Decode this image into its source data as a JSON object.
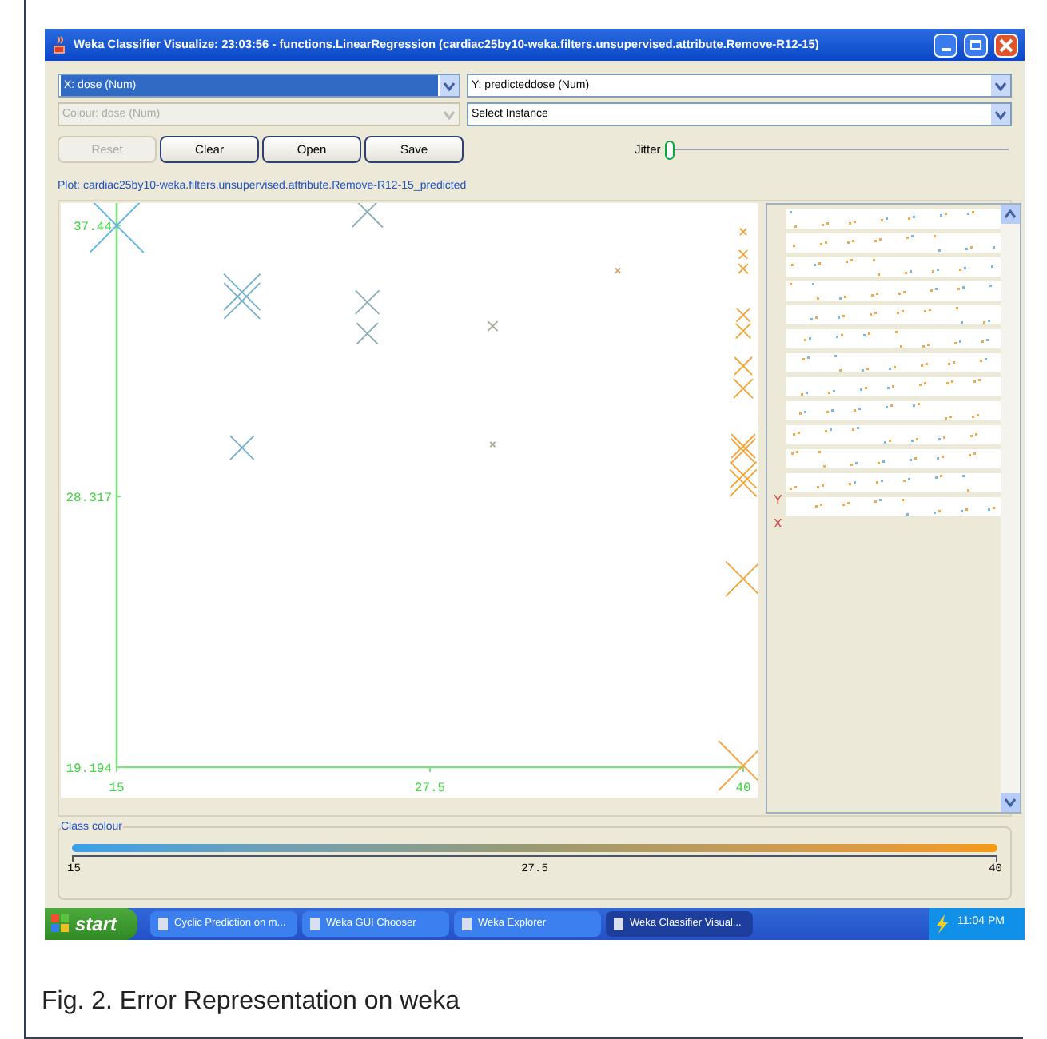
{
  "window": {
    "title": "Weka Classifier Visualize: 23:03:56 - functions.LinearRegression (cardiac25by10-weka.filters.unsupervised.attribute.Remove-R12-15)"
  },
  "selectors": [
    {
      "value": "X: dose (Num)",
      "selected": true,
      "disabled": false
    },
    {
      "value": "Y: predicteddose (Num)",
      "selected": false,
      "disabled": false
    },
    {
      "value": "Colour: dose (Num)",
      "selected": false,
      "disabled": true
    },
    {
      "value": "Select Instance",
      "selected": false,
      "disabled": false
    }
  ],
  "buttons": [
    {
      "label": "Reset",
      "disabled": true
    },
    {
      "label": "Clear",
      "disabled": false
    },
    {
      "label": "Open",
      "disabled": false
    },
    {
      "label": "Save",
      "disabled": false
    }
  ],
  "jitter": {
    "label": "Jitter",
    "level": 0
  },
  "plot": {
    "title": "Plot: cardiac25by10-weka.filters.unsupervised.attribute.Remove-R12-15_predicted",
    "chart_data": {
      "type": "scatter",
      "xlim": [
        15,
        40
      ],
      "ylim": [
        19.194,
        38.2
      ],
      "xticks": [
        15,
        27.5,
        40
      ],
      "yticks": [
        19.194,
        28.317,
        37.44
      ],
      "x": [
        15,
        20,
        20,
        25,
        25,
        25,
        20,
        30,
        30,
        35,
        40,
        40,
        40,
        40,
        40,
        40,
        40,
        40,
        40,
        40,
        40,
        40,
        40
      ],
      "series": [
        {
          "values": [
            37.44,
            35.2,
            34.9,
            37.9,
            34.86,
            33.8,
            29.96,
            34.05,
            30.07,
            35.93,
            37.23,
            36.47,
            35.99,
            34.43,
            33.89,
            32.71,
            31.95,
            30.01,
            29.85,
            29.04,
            28.77,
            25.54,
            19.25
          ]
        }
      ]
    }
  },
  "matrix": {
    "y_label": "Y",
    "x_label": "X"
  },
  "class_colour": {
    "title": "Class colour",
    "ticks": [
      "15",
      "27.5",
      "40"
    ]
  },
  "taskbar": {
    "start": "start",
    "tasks": [
      {
        "label": "Cyclic Prediction on m...",
        "selected": false
      },
      {
        "label": "Weka GUI Chooser",
        "selected": false
      },
      {
        "label": "Weka Explorer",
        "selected": false
      },
      {
        "label": "Weka Classifier Visual...",
        "selected": true
      }
    ],
    "clock": "11:04 PM"
  },
  "caption": "Fig. 2. Error Representation on weka"
}
